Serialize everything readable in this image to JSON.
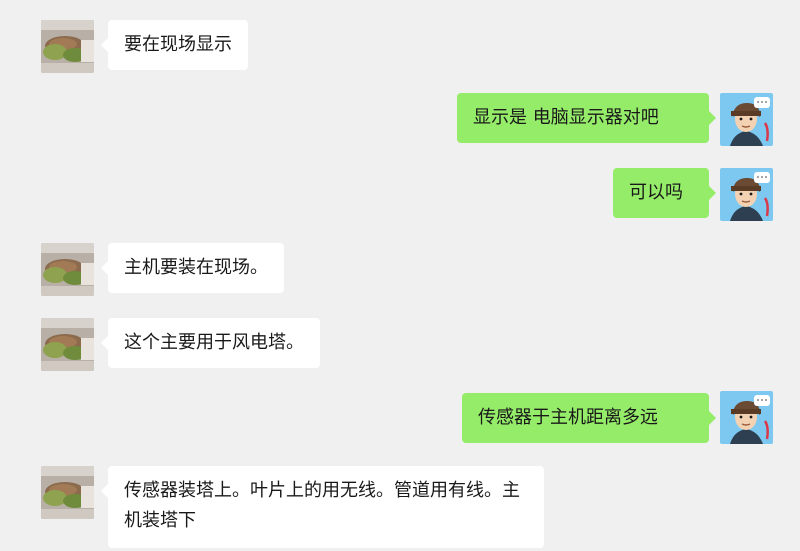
{
  "chat": {
    "messages": [
      {
        "side": "left",
        "text": "要在现场显示"
      },
      {
        "side": "right",
        "text": "显示是 电脑显示器对吧"
      },
      {
        "side": "right",
        "text": "可以吗"
      },
      {
        "side": "left",
        "text": "主机要装在现场。"
      },
      {
        "side": "left",
        "text": "这个主要用于风电塔。"
      },
      {
        "side": "right",
        "text": "传感器于主机距离多远"
      },
      {
        "side": "left",
        "text": "传感器装塔上。叶片上的用无线。管道用有线。主机装塔下"
      }
    ]
  },
  "colors": {
    "background": "#f0f0f0",
    "incoming_bubble": "#ffffff",
    "outgoing_bubble": "#95ec69",
    "text": "#191919"
  },
  "icons": {
    "left_avatar": "food-photo-avatar",
    "right_avatar": "cartoon-man-avatar"
  }
}
